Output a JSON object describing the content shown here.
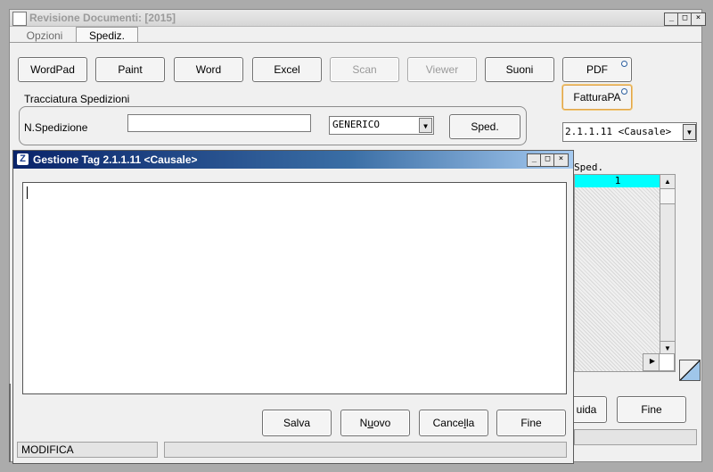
{
  "window": {
    "title": "Revisione Documenti: [2015]",
    "min": "_",
    "max": "□",
    "close": "×"
  },
  "tabs": [
    {
      "label": "Opzioni"
    },
    {
      "label": "Spediz."
    }
  ],
  "toolbar": {
    "wordpad": "WordPad",
    "paint": "Paint",
    "word": "Word",
    "excel": "Excel",
    "scan": "Scan",
    "viewer": "Viewer",
    "suoni": "Suoni",
    "pdf": "PDF",
    "fatturapa": "FatturaPA"
  },
  "tracciatura": {
    "group_label": "Tracciatura Spedizioni",
    "nspedizione_label": "N.Spedizione",
    "nspedizione_value": "",
    "tipo_value": "GENERICO",
    "sped_button": "Sped."
  },
  "right_panel": {
    "tag_select_value": "2.1.1.11 <Causale>",
    "list_header": "Sped.",
    "list_rows": [
      "1"
    ],
    "guida_button": "uida",
    "fine_button": "Fine"
  },
  "dialog": {
    "title": "Gestione Tag 2.1.1.11 <Causale>",
    "text_value": "",
    "salva": "Salva",
    "nuovo_pre": "N",
    "nuovo_u": "u",
    "nuovo_post": "ovo",
    "cancella_pre": "Cance",
    "cancella_u": "l",
    "cancella_post": "la",
    "fine": "Fine",
    "status_mode": "MODIFICA"
  }
}
